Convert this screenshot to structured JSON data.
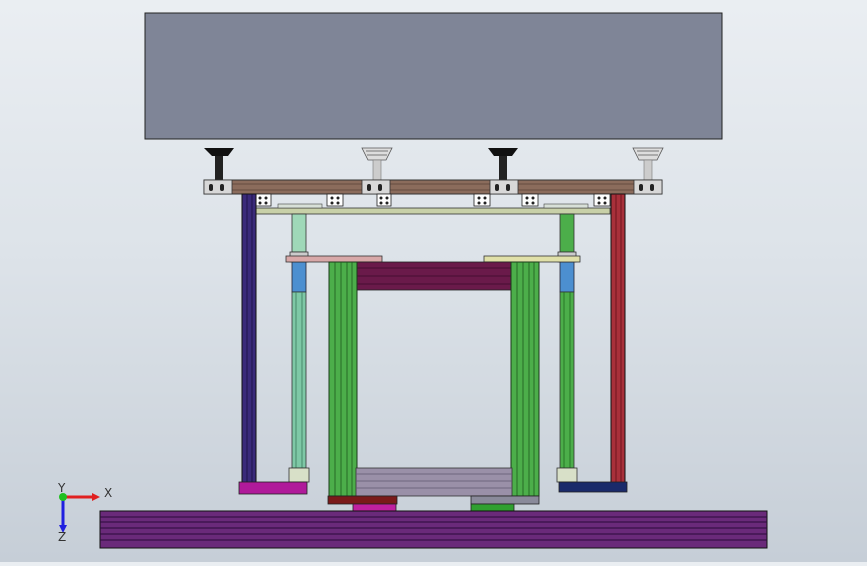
{
  "viewport": {
    "background_top": "#eaeef2",
    "background_bottom": "#c6ced7"
  },
  "model": {
    "upper_panel_color": "#7f8597",
    "cross_beam_color": "#8b6c5c",
    "left_post_color": "#3a2a7a",
    "right_post_color": "#a8303a",
    "inner_guide_color": "#4cae4a",
    "inner_guide_left_color": "#7ec8a6",
    "cylinder_color": "#4c8fd0",
    "top_box_color": "#6a1a4a",
    "base_rail_color": "#6a2a7a",
    "left_foot_color": "#b01a9a",
    "right_foot_color": "#1a2a6a",
    "center_foot_left_color": "#7a1a1a",
    "center_foot_right_color": "#8a8a9a",
    "lower_block_left_color": "#c020a0",
    "lower_block_right_color": "#30a030"
  },
  "triad": {
    "x_label": "X",
    "y_label": "Y",
    "z_label": "Z",
    "x_color": "#e02020",
    "y_color": "#20c020",
    "z_color": "#2020e0"
  }
}
